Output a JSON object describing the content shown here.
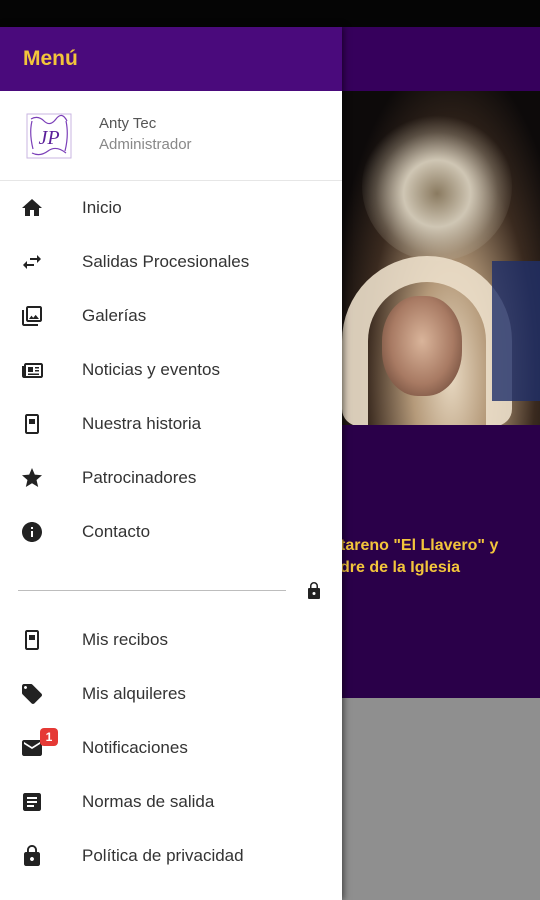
{
  "drawer": {
    "title": "Menú",
    "profile": {
      "name": "Anty Tec",
      "role": "Administrador"
    }
  },
  "menu_primary": [
    {
      "label": "Inicio",
      "icon": "home-icon"
    },
    {
      "label": "Salidas Procesionales",
      "icon": "swap-arrows-icon"
    },
    {
      "label": "Galerías",
      "icon": "gallery-icon"
    },
    {
      "label": "Noticias y eventos",
      "icon": "newspaper-icon"
    },
    {
      "label": "Nuestra historia",
      "icon": "book-icon"
    },
    {
      "label": "Patrocinadores",
      "icon": "star-icon"
    },
    {
      "label": "Contacto",
      "icon": "info-icon"
    }
  ],
  "menu_secondary": [
    {
      "label": "Mis recibos",
      "icon": "receipt-icon"
    },
    {
      "label": "Mis alquileres",
      "icon": "tag-icon"
    },
    {
      "label": "Notificaciones",
      "icon": "mail-icon",
      "badge": "1"
    },
    {
      "label": "Normas de salida",
      "icon": "document-icon"
    },
    {
      "label": "Política de privacidad",
      "icon": "lock-icon"
    }
  ],
  "background": {
    "caption_line1": "tareno \"El Llavero\" y",
    "caption_line2": "dre de la Iglesia"
  },
  "colors": {
    "header_purple": "#4a0a7c",
    "title_yellow": "#f3c53b",
    "badge_red": "#e53935"
  }
}
